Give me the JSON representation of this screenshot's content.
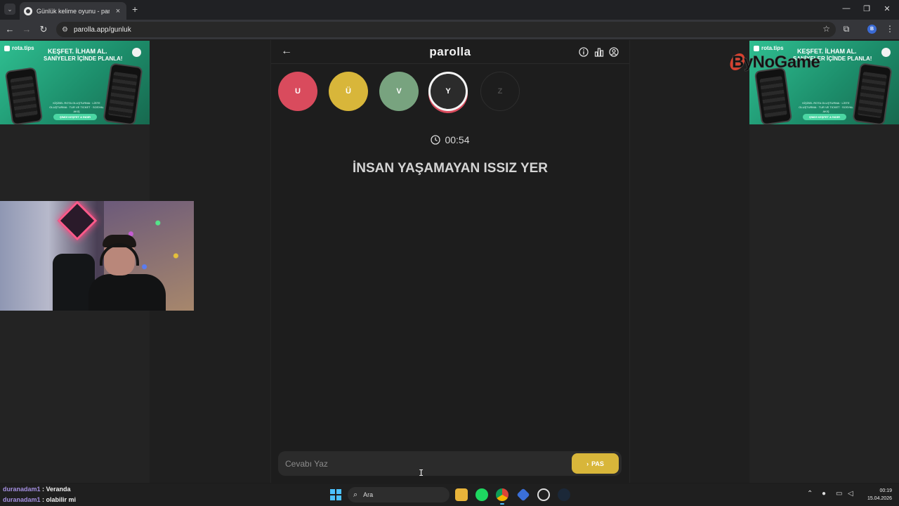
{
  "browser": {
    "tab_title": "Günlük kelime oyunu - parolla",
    "url": "parolla.app/gunluk",
    "profile_initial": "B"
  },
  "ad": {
    "brand": "rota.tips",
    "headline1": "KEŞFET. İLHAM AL.",
    "headline2": "SANİYELER İÇİNDE PLANLA!",
    "description": "KİŞİSEL ROTA OLUŞTURMA · LİSTE OLUŞTURMA · TUR VE TICKET · SOSYAL AKIŞ",
    "cta": "ŞİMDİ KEŞFET & İNDİR",
    "accent": "#2fbf91"
  },
  "app": {
    "logo": "parolla",
    "letters": [
      {
        "char": "U",
        "state": "wrong",
        "color": "#d94b5d"
      },
      {
        "char": "Ü",
        "state": "passed",
        "color": "#d8b63a"
      },
      {
        "char": "V",
        "state": "correct",
        "color": "#78a37f"
      },
      {
        "char": "Y",
        "state": "current",
        "color": "#2b2b2b"
      },
      {
        "char": "Z",
        "state": "pending",
        "color": "#1d1d1d"
      }
    ],
    "timer": "00:54",
    "clue": "İNSAN YAŞAMAYAN ISSIZ YER",
    "answer_placeholder": "Cevabı Yaz",
    "answer_value": "",
    "pas_label": "PAS"
  },
  "watermark": {
    "text": "ByNoGame"
  },
  "chat": [
    {
      "user": "duranadam1",
      "message": "Veranda"
    },
    {
      "user": "duranadam1",
      "message": "olabilir mi"
    }
  ],
  "taskbar": {
    "search_label": "Ara",
    "time": "00:19",
    "date": "15.04.2026"
  }
}
